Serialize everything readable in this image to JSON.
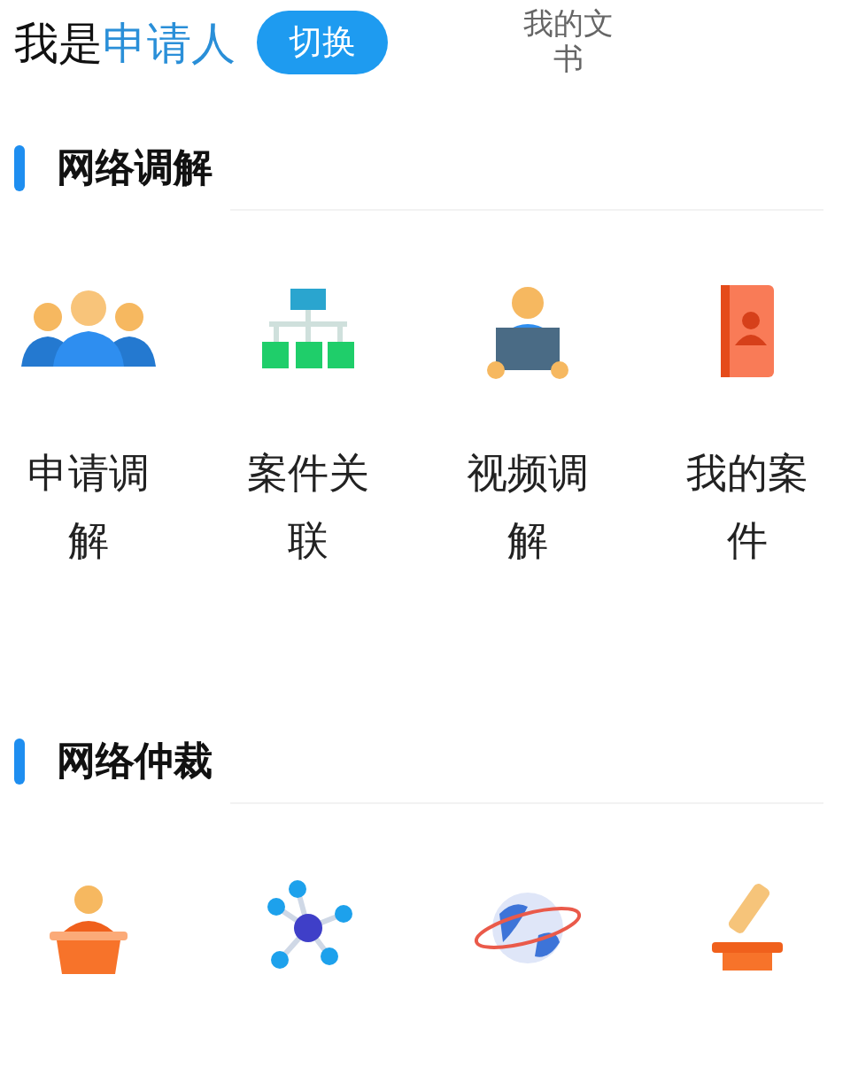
{
  "header": {
    "prefix": "我是",
    "role": "申请人",
    "switch_button": "切换",
    "documents_link": "我的文书"
  },
  "sections": [
    {
      "title": "网络调解",
      "items": [
        {
          "kind": "people",
          "label": "申请调解"
        },
        {
          "kind": "hierarchy",
          "label": "案件关联"
        },
        {
          "kind": "presenter",
          "label": "视频调解"
        },
        {
          "kind": "contacts",
          "label": "我的案件"
        }
      ]
    },
    {
      "title": "网络仲裁",
      "items": [
        {
          "kind": "podium"
        },
        {
          "kind": "network"
        },
        {
          "kind": "globe"
        },
        {
          "kind": "gavel"
        }
      ]
    }
  ]
}
